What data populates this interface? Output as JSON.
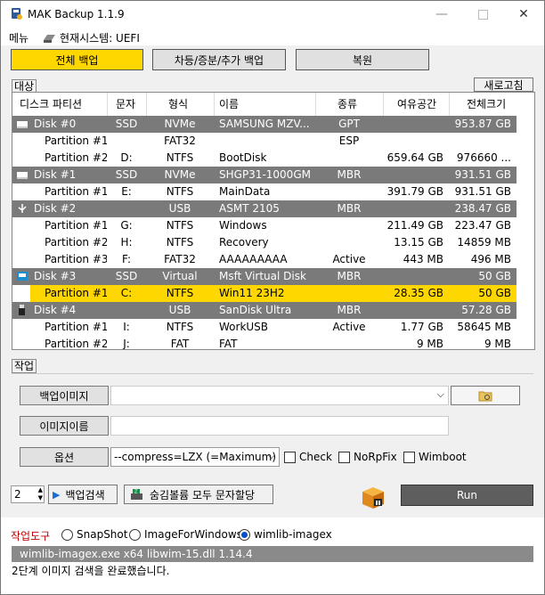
{
  "window": {
    "title": "MAK Backup 1.1.9"
  },
  "menu": {
    "menu_label": "메뉴",
    "system_label": "현재시스템: UEFI"
  },
  "modes": {
    "full_backup": "전체 백업",
    "incremental_backup": "차등/증분/추가 백업",
    "restore": "복원"
  },
  "target": {
    "group_label": "대상",
    "refresh_label": "새로고침"
  },
  "table": {
    "headers": [
      "디스크 파티션",
      "문자",
      "형식",
      "이름",
      "종류",
      "여유공간",
      "전체크기"
    ],
    "rows": [
      {
        "kind": "disk",
        "icon": "hdd-icon",
        "cells": [
          "Disk #0",
          "SSD",
          "NVMe",
          "SAMSUNG MZV...",
          "GPT",
          "",
          "953.87 GB"
        ]
      },
      {
        "kind": "part",
        "cells": [
          "Partition #1",
          "",
          "FAT32",
          "",
          "ESP",
          "",
          ""
        ]
      },
      {
        "kind": "part",
        "cells": [
          "Partition #2",
          "D:",
          "NTFS",
          "BootDisk",
          "",
          "659.64 GB",
          "976660 ..."
        ]
      },
      {
        "kind": "disk",
        "icon": "hdd-icon",
        "cells": [
          "Disk #1",
          "SSD",
          "NVMe",
          "SHGP31-1000GM",
          "MBR",
          "",
          "931.51 GB"
        ]
      },
      {
        "kind": "part",
        "cells": [
          "Partition #1",
          "E:",
          "NTFS",
          "MainData",
          "",
          "391.79 GB",
          "931.51 GB"
        ]
      },
      {
        "kind": "disk",
        "icon": "usb-icon",
        "cells": [
          "Disk #2",
          "",
          "USB",
          "ASMT 2105",
          "MBR",
          "",
          "238.47 GB"
        ]
      },
      {
        "kind": "part",
        "cells": [
          "Partition #1",
          "G:",
          "NTFS",
          "Windows",
          "",
          "211.49 GB",
          "223.47 GB"
        ]
      },
      {
        "kind": "part",
        "cells": [
          "Partition #2",
          "H:",
          "NTFS",
          "Recovery",
          "",
          "13.15 GB",
          "14859 MB"
        ]
      },
      {
        "kind": "part",
        "cells": [
          "Partition #3",
          "F:",
          "FAT32",
          "AAAAAAAAA",
          "Active",
          "443 MB",
          "496 MB"
        ]
      },
      {
        "kind": "disk",
        "icon": "virtual-disk-icon",
        "cells": [
          "Disk #3",
          "SSD",
          "Virtual",
          "Msft Virtual Disk",
          "MBR",
          "",
          "50 GB"
        ]
      },
      {
        "kind": "sel",
        "cells": [
          "Partition #1",
          "C:",
          "NTFS",
          "Win11 23H2",
          "",
          "28.35 GB",
          "50 GB"
        ]
      },
      {
        "kind": "disk",
        "icon": "usb-stick-icon",
        "cells": [
          "Disk #4",
          "",
          "USB",
          "SanDisk Ultra",
          "MBR",
          "",
          "57.28 GB"
        ]
      },
      {
        "kind": "part",
        "cells": [
          "Partition #1",
          "I:",
          "NTFS",
          "WorkUSB",
          "Active",
          "1.77 GB",
          "58645 MB"
        ]
      },
      {
        "kind": "part",
        "cells": [
          "Partition #2",
          "J:",
          "FAT",
          "FAT",
          "",
          "9 MB",
          "9 MB"
        ]
      }
    ]
  },
  "task": {
    "group_label": "작업",
    "backup_image_label": "백업이미지",
    "backup_image_value": "",
    "image_name_label": "이미지이름",
    "image_name_value": "",
    "options_label": "옵션",
    "compress_value": "--compress=LZX (=Maximum)",
    "check_label": "Check",
    "norpfix_label": "NoRpFix",
    "wimboot_label": "Wimboot",
    "count_value": "2",
    "search_label": "백업검색",
    "assign_label": "숨김볼륨 모두 문자할당",
    "run_label": "Run"
  },
  "tools": {
    "label": "작업도구",
    "options": [
      "SnapShot",
      "ImageForWindows",
      "wimlib-imagex"
    ],
    "selected": "wimlib-imagex",
    "status_line": "wimlib-imagex.exe x64 libwim-15.dll 1.14.4",
    "message": "2단계 이미지 검색을 완료했습니다."
  },
  "colors": {
    "accent_yellow": "#ffd700",
    "disk_row_gray": "#7a7a7a",
    "tool_label_red": "#c00000"
  }
}
